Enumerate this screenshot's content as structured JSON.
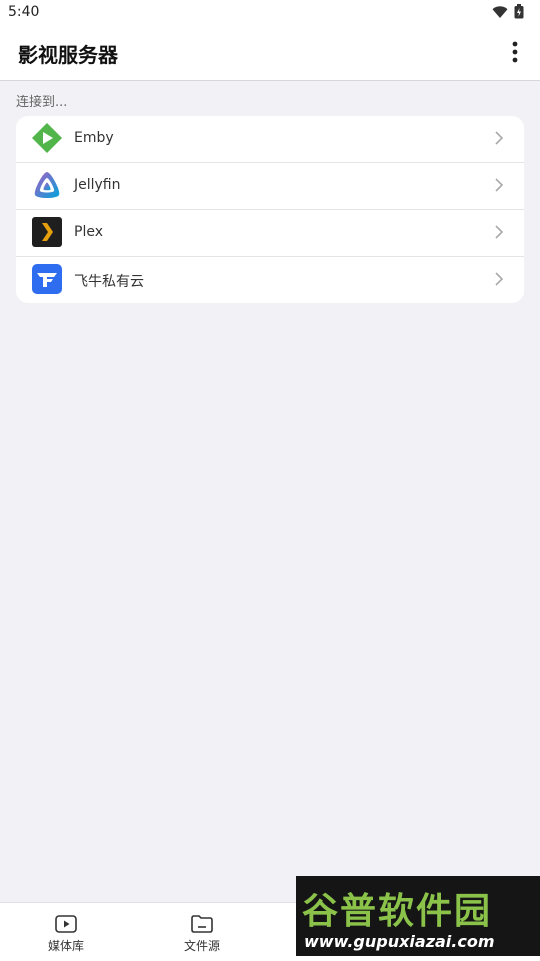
{
  "status": {
    "time": "5:40"
  },
  "appbar": {
    "title": "影视服务器"
  },
  "section": {
    "label": "连接到..."
  },
  "servers": [
    {
      "label": "Emby",
      "icon": "emby-icon"
    },
    {
      "label": "Jellyfin",
      "icon": "jellyfin-icon"
    },
    {
      "label": "Plex",
      "icon": "plex-icon"
    },
    {
      "label": "飞牛私有云",
      "icon": "fnos-icon"
    }
  ],
  "nav": [
    {
      "label": "媒体库",
      "icon": "play-box-icon"
    },
    {
      "label": "文件源",
      "icon": "folder-icon"
    }
  ],
  "watermark": {
    "top": "谷普软件园",
    "bottom": "www.gupuxiazai.com"
  },
  "colors": {
    "background": "#f1f1f6",
    "card": "#ffffff",
    "emby": "#52b54b",
    "plex": "#e5a00d",
    "fnos": "#2f6df0"
  }
}
